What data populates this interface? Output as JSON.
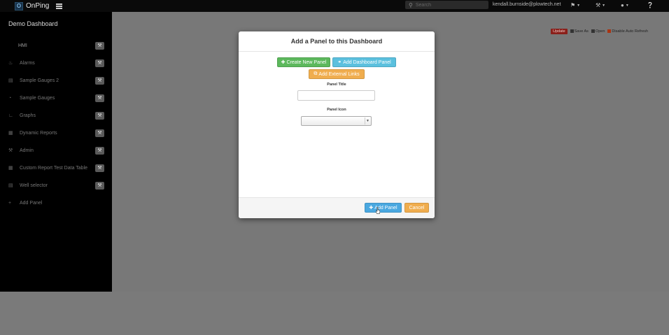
{
  "navbar": {
    "brand_logo": "O",
    "brand_name": "OnPing",
    "search_placeholder": "Search",
    "user_email": "kendall.burnside@plowtech.net",
    "icons": [
      "bookmark-icon",
      "wrench-icon",
      "user-icon",
      "help-icon"
    ]
  },
  "sidebar": {
    "dashboard_title": "Demo Dashboard",
    "items": [
      {
        "label": "HMI",
        "icon": ""
      },
      {
        "label": "Alarms",
        "icon": "bell-icon"
      },
      {
        "label": "Sample Gauges 2",
        "icon": "chart-icon"
      },
      {
        "label": "Sample Gauges",
        "icon": "gauge-icon"
      },
      {
        "label": "Graphs",
        "icon": "line-chart-icon"
      },
      {
        "label": "Dynamic Reports",
        "icon": "report-icon"
      },
      {
        "label": "Admin",
        "icon": "wrench-icon"
      },
      {
        "label": "Custom Report Test Data Table",
        "icon": "report-icon"
      },
      {
        "label": "Well selector",
        "icon": "chart-icon"
      },
      {
        "label": "Add Panel",
        "icon": "plus-icon"
      }
    ]
  },
  "toolbar": {
    "update_label": "Update",
    "save_as_label": "Save As",
    "open_label": "Open",
    "disable_refresh_label": "Disable Auto Refresh"
  },
  "modal": {
    "title": "Add a Panel to this Dashboard",
    "create_new_label": "Create New Panel",
    "add_dashboard_label": "Add Dashboard Panel",
    "add_external_label": "Add External Links",
    "panel_title_label": "Panel Title",
    "panel_title_value": "",
    "panel_icon_label": "Panel Icon",
    "panel_icon_value": "",
    "add_panel_label": "Add Panel",
    "cancel_label": "Cancel"
  },
  "colors": {
    "green": "#5cb85c",
    "blue": "#5bc0de",
    "orange": "#f0ad4e",
    "primary": "#4aa8e0",
    "update_red": "#8a1f1a"
  }
}
